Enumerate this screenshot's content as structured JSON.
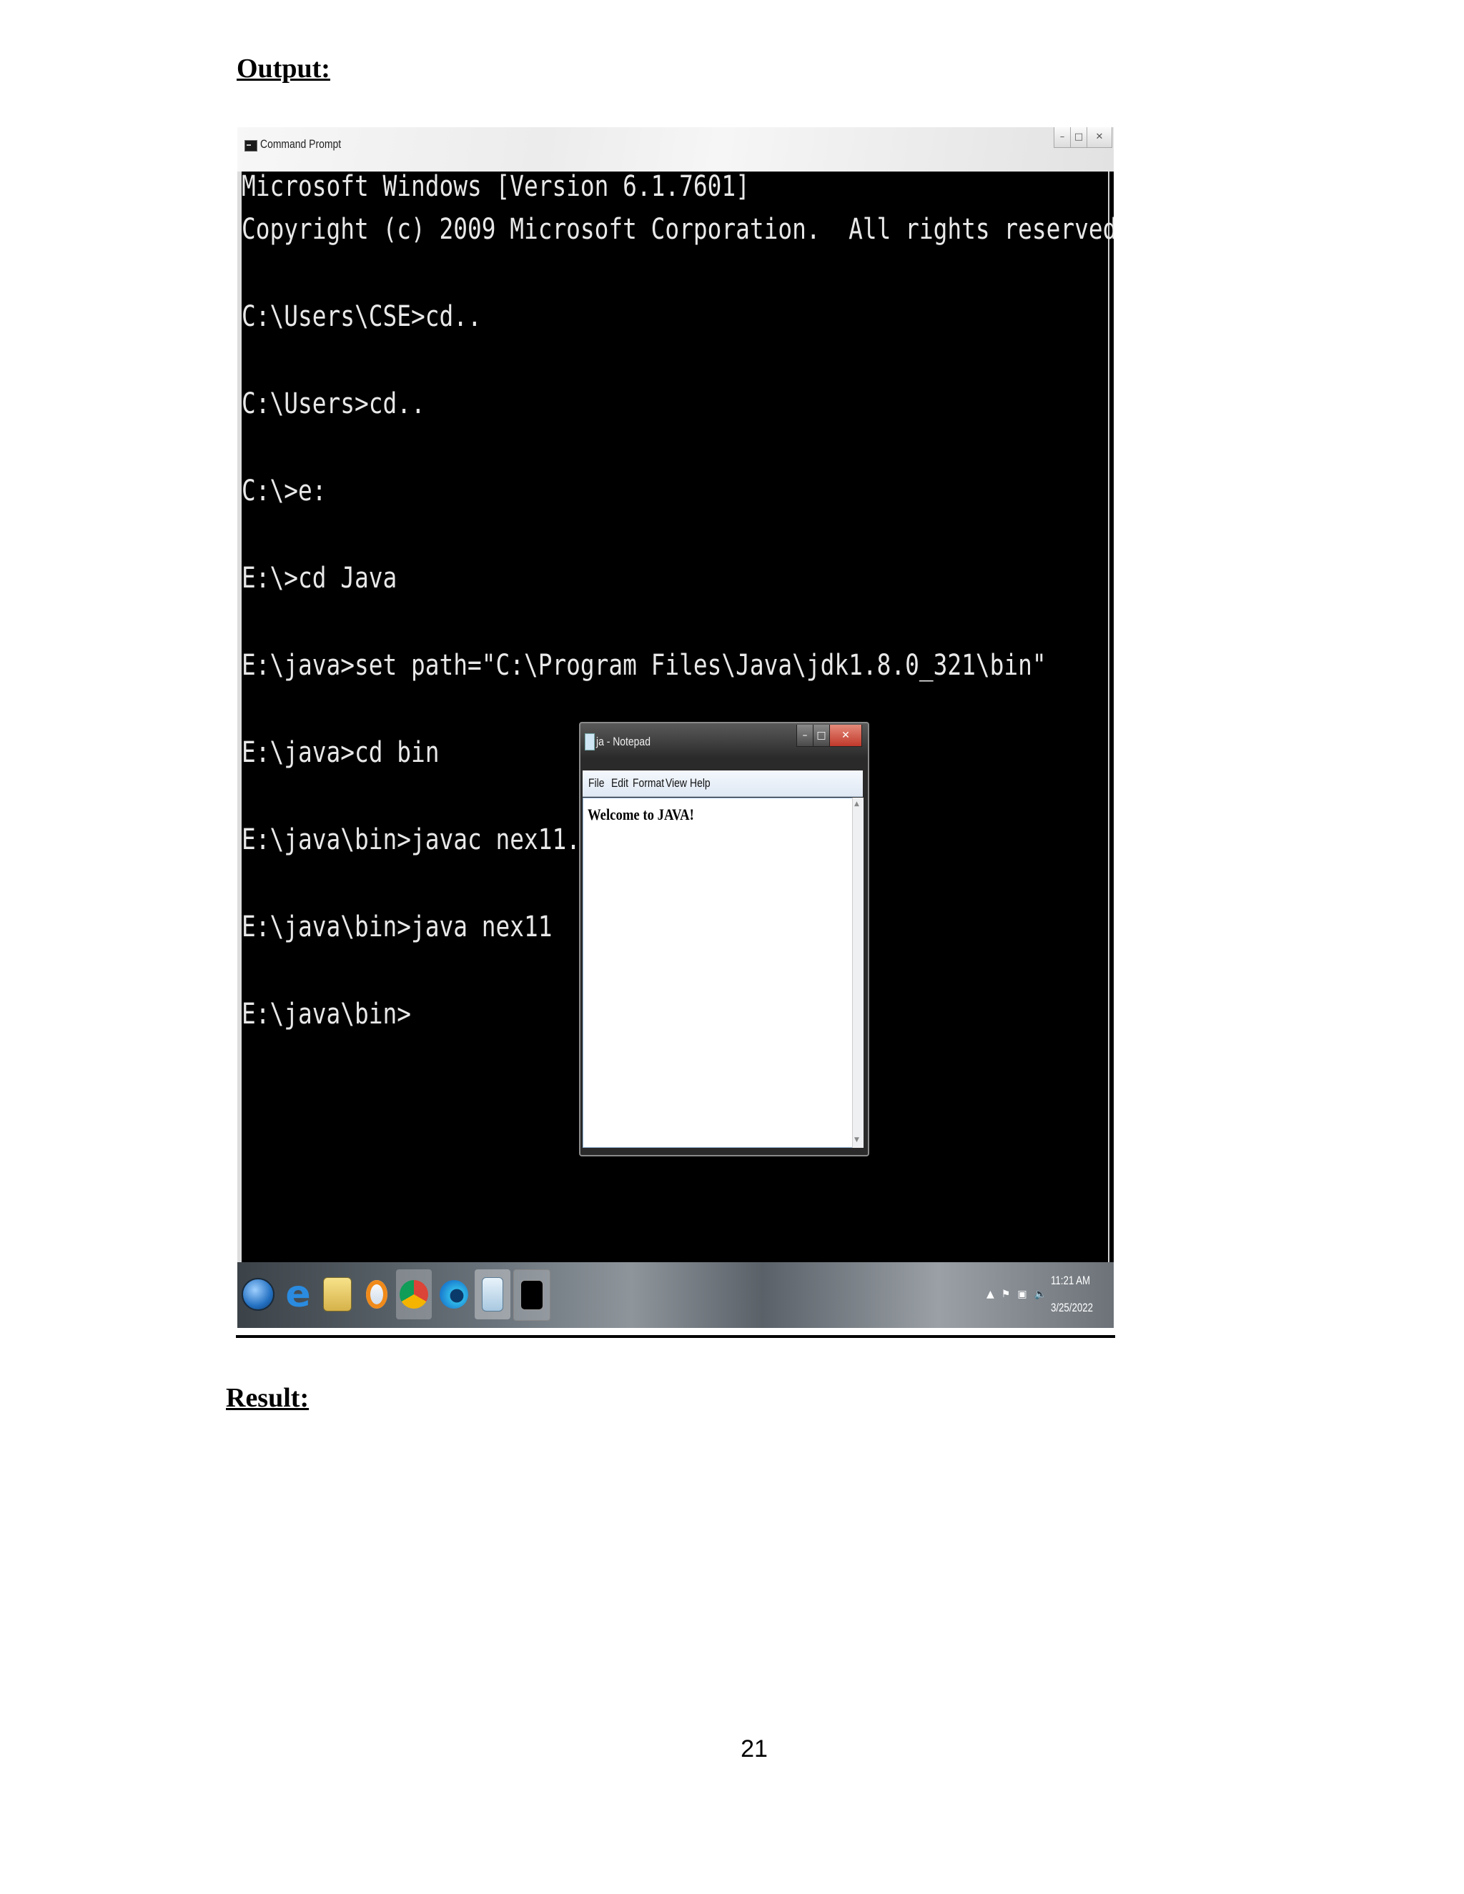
{
  "document": {
    "output_heading": "Output:",
    "result_heading": "Result:",
    "page_number": "21"
  },
  "command_prompt": {
    "title": "Command Prompt",
    "lines": [
      "Microsoft Windows [Version 6.1.7601]",
      "Copyright (c) 2009 Microsoft Corporation.  All rights reserved.",
      "C:\\Users\\CSE>cd..",
      "C:\\Users>cd..",
      "C:\\>e:",
      "E:\\>cd Java",
      "E:\\java>set path=\"C:\\Program Files\\Java\\jdk1.8.0_321\\bin\"",
      "E:\\java>cd bin",
      "E:\\java\\bin>javac nex11.java",
      "E:\\java\\bin>java nex11",
      "E:\\java\\bin>"
    ]
  },
  "notepad": {
    "title": "ja - Notepad",
    "menu": [
      "File",
      "Edit",
      "Format",
      "View",
      "Help"
    ],
    "content": "Welcome to JAVA!"
  },
  "taskbar": {
    "clock_time": "11:21 AM",
    "clock_date": "3/25/2022"
  },
  "colors": {
    "console_background": "#000000",
    "console_text": "#e8e8e8",
    "notepad_close": "#c0392b"
  }
}
